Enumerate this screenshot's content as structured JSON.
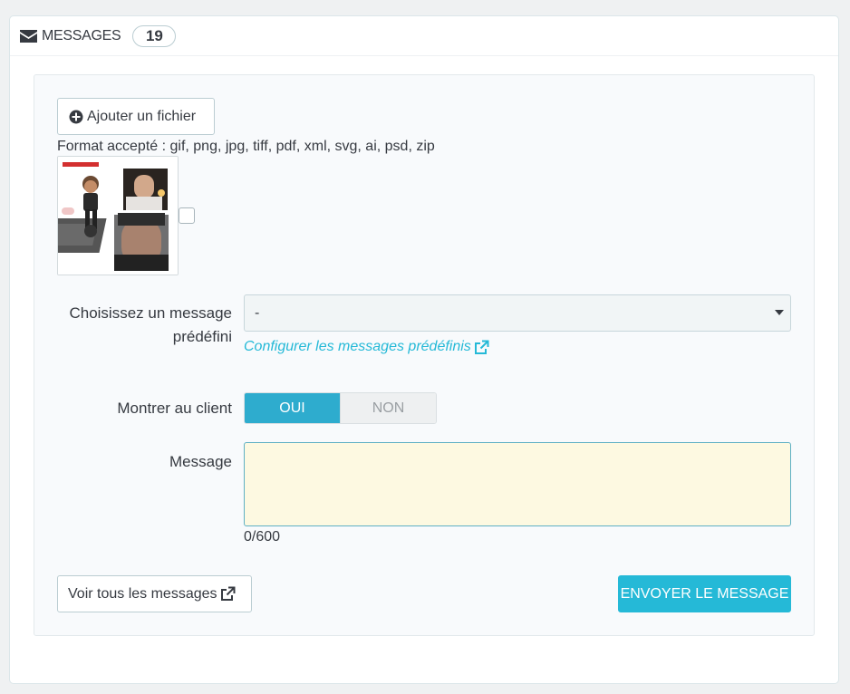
{
  "header": {
    "icon": "envelope-icon",
    "title": "MESSAGES",
    "count": "19"
  },
  "attachment": {
    "add_file_icon": "plus-circle-icon",
    "add_file_label": "Ajouter un fichier",
    "formats": "Format accepté : gif, png, jpg, tiff, pdf, xml, svg, ai, psd, zip",
    "thumbnail_checked": false
  },
  "predefined": {
    "label": "Choisissez un message prédéfini",
    "selected": "-",
    "configure_link": "Configurer les messages prédéfinis",
    "link_icon": "external-link-icon"
  },
  "show_customer": {
    "label": "Montrer au client",
    "yes": "OUI",
    "no": "NON",
    "value": "yes"
  },
  "message": {
    "label": "Message",
    "value": "",
    "counter": "0/600"
  },
  "footer": {
    "view_all": "Voir tous les messages",
    "view_all_icon": "external-link-icon",
    "send": "ENVOYER LE MESSAGE"
  },
  "colors": {
    "primary": "#25b9d7",
    "toggle_on": "#2eacce",
    "textarea_bg": "#fdf9e1"
  }
}
